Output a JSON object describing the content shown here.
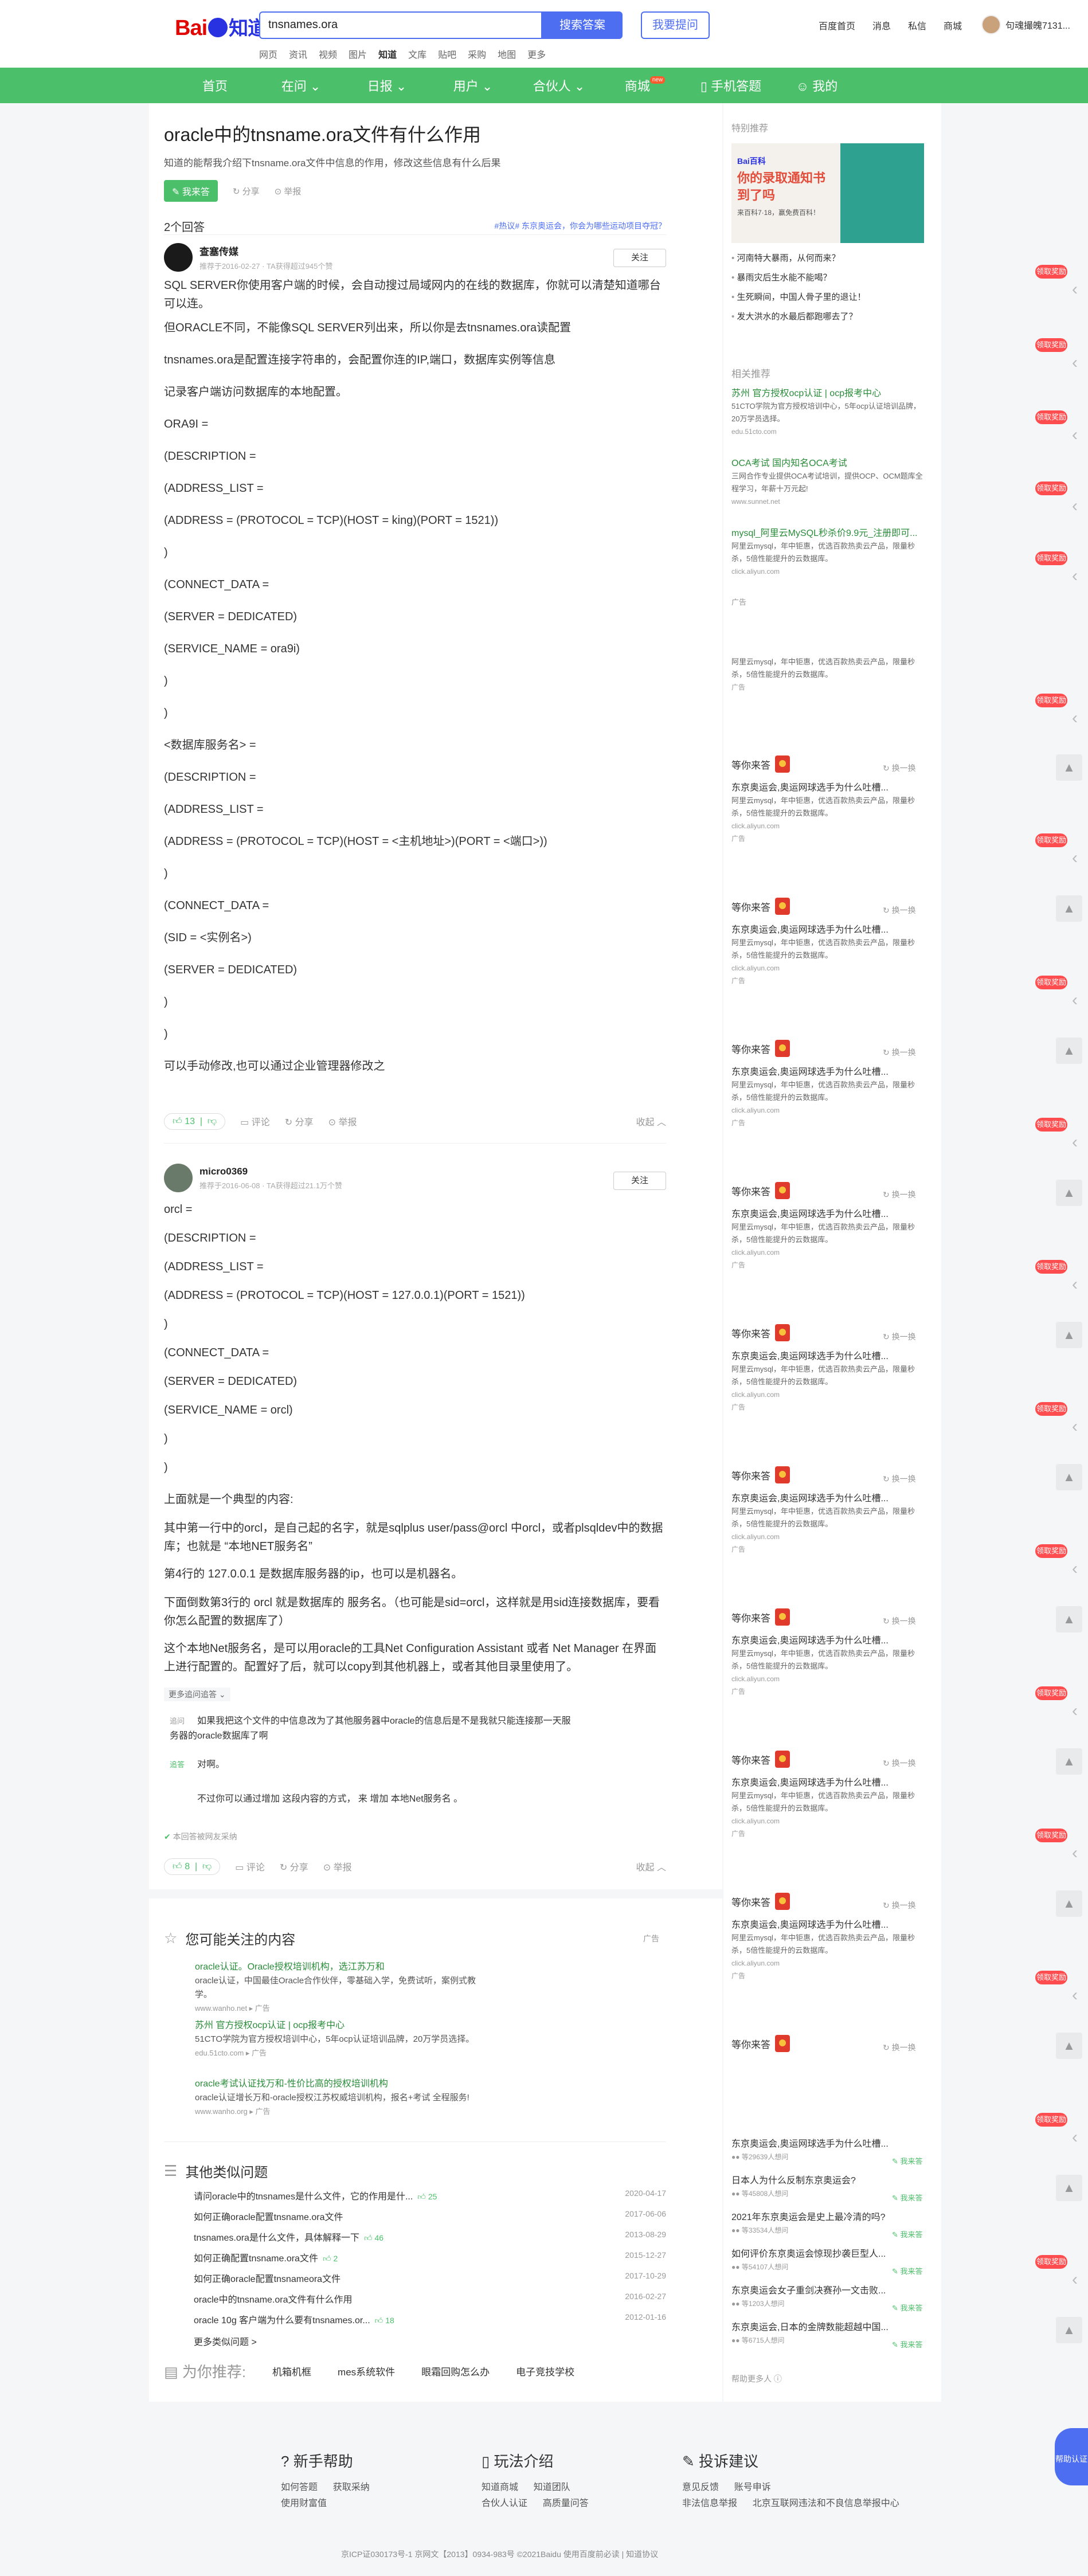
{
  "header": {
    "logo": {
      "bai": "Bai",
      "du": "du",
      "zhidao": "知道"
    },
    "search_value": "tnsnames.ora",
    "search_button": "搜索答案",
    "ask_button": "我要提问",
    "subnav": [
      "网页",
      "资讯",
      "视频",
      "图片",
      "知道",
      "文库",
      "贴吧",
      "采购",
      "地图",
      "更多"
    ],
    "links": [
      "百度首页",
      "消息",
      "私信",
      "商城"
    ],
    "username": "句魂撮魄7131..."
  },
  "nav": {
    "items": [
      "首页",
      "在问",
      "日报",
      "用户",
      "合伙人",
      "商城",
      "手机答题",
      "我的"
    ],
    "new_badge": "new"
  },
  "question": {
    "title": "oracle中的tnsname.ora文件有什么作用",
    "desc": "知道的能帮我介绍下tnsname.ora文件中信息的作用，修改这些信息有什么后果",
    "want_answer": "我来答",
    "share": "分享",
    "report": "举报"
  },
  "answers_bar": {
    "count": "2个回答",
    "hot": "#热议# 东京奥运会，你会为哪些运动项目夺冠？"
  },
  "answer1": {
    "name": "查塞传媒",
    "meta": "推荐于2016-02-27 · TA获得超过945个赞",
    "follow": "关注",
    "paras": [
      "SQL SERVER你使用客户端的时候，会自动搜过局域网内的在线的数据库，你就可以清楚知道哪台可以连。",
      "但ORACLE不同，不能像SQL SERVER列出来，所以你是去tnsnames.ora读配置",
      "tnsnames.ora是配置连接字符串的，会配置你连的IP,端口，数据库实例等信息",
      "记录客户端访问数据库的本地配置。",
      "ORA9I =",
      "(DESCRIPTION =",
      "(ADDRESS_LIST =",
      "(ADDRESS = (PROTOCOL = TCP)(HOST = king)(PORT = 1521))",
      ")",
      "(CONNECT_DATA =",
      "(SERVER = DEDICATED)",
      "(SERVICE_NAME = ora9i)",
      ")",
      ")",
      "<数据库服务名> =",
      "(DESCRIPTION =",
      "(ADDRESS_LIST =",
      "(ADDRESS = (PROTOCOL = TCP)(HOST = <主机地址>)(PORT = <端口>))",
      ")",
      "(CONNECT_DATA =",
      "(SID = <实例名>)",
      "(SERVER = DEDICATED)",
      ")",
      ")",
      "可以手动修改,也可以通过企业管理器修改之"
    ],
    "likes": "13",
    "comment": "评论",
    "share": "分享",
    "report": "举报",
    "fold": "收起"
  },
  "answer2": {
    "name": "micro0369",
    "meta": "推荐于2016-06-08 · TA获得超过21.1万个赞",
    "follow": "关注",
    "paras": [
      "orcl =",
      "(DESCRIPTION =",
      "(ADDRESS_LIST =",
      "(ADDRESS = (PROTOCOL = TCP)(HOST = 127.0.0.1)(PORT = 1521))",
      ")",
      "(CONNECT_DATA =",
      "(SERVER = DEDICATED)",
      "(SERVICE_NAME = orcl)",
      ")",
      ")",
      "上面就是一个典型的内容:",
      "其中第一行中的orcl，是自己起的名字，就是sqlplus user/pass@orcl 中orcl，或者plsqldev中的数据库；也就是 “本地NET服务名”",
      "第4行的 127.0.0.1 是数据库服务器的ip，也可以是机器名。",
      "下面倒数第3行的 orcl 就是数据库的 服务名。（也可能是sid=orcl，这样就是用sid连接数据库，要看你怎么配置的数据库了）",
      "这个本地Net服务名，是可以用oracle的工具Net Configuration Assistant 或者 Net Manager 在界面上进行配置的。配置好了后，就可以copy到其他机器上，或者其他目录里使用了。"
    ],
    "more_qa": "更多追问追答",
    "q_tag": "追问",
    "q_text": "如果我把这个文件的中信息改为了其他服务器中oracle的信息后是不是我就只能连接那一天服务器的oracle数据库了啊",
    "a_tag": "追答",
    "a_text1": "对啊。",
    "a_text2": "不过你可以通过增加 这段内容的方式，  来 增加 本地Net服务名 。",
    "verify": "本回答被网友采纳",
    "likes": "8",
    "comment": "评论",
    "share": "分享",
    "report": "举报",
    "fold": "收起"
  },
  "interest": {
    "title": "您可能关注的内容",
    "ad": "广告",
    "items": [
      {
        "t": "oracle认证。Oracle授权培训机构，选江苏万和",
        "d": "oracle认证，中国最佳Oracle合作伙伴，零基础入学，免费试听，案例式教学。",
        "u": "www.wanho.net  ▸  广告"
      },
      {
        "t": "苏州 官方授权ocp认证 | ocp报考中心",
        "d": "51CTO学院为官方授权培训中心，5年ocp认证培训品牌，20万学员选择。",
        "u": "edu.51cto.com  ▸  广告"
      },
      {
        "t": "oracle考试认证找万和-性价比高的授权培训机构",
        "d": "oracle认证增长万和-oracle授权江苏权威培训机构，报名+考试 全程服务!",
        "u": "www.wanho.org  ▸  广告"
      }
    ]
  },
  "similar": {
    "title": "其他类似问题",
    "items": [
      {
        "q": "请问oracle中的tnsnames是什么文件，它的作用是什...",
        "c": "25",
        "d": "2020-04-17"
      },
      {
        "q": "如何正确oracle配置tnsname.ora文件",
        "c": "",
        "d": "2017-06-06"
      },
      {
        "q": "tnsnames.ora是什么文件，具体解释一下",
        "c": "46",
        "d": "2013-08-29"
      },
      {
        "q": "如何正确配置tnsname.ora文件",
        "c": "2",
        "d": "2015-12-27"
      },
      {
        "q": "如何正确oracle配置tnsnameora文件",
        "c": "",
        "d": "2017-10-29"
      },
      {
        "q": "oracle中的tnsname.ora文件有什么作用",
        "c": "",
        "d": "2016-02-27"
      },
      {
        "q": "oracle 10g 客户端为什么要有tnsnames.or...",
        "c": "18",
        "d": "2012-01-16"
      }
    ],
    "more": "更多类似问题 >"
  },
  "recommend": {
    "label": "为你推荐:",
    "items": [
      "机箱机框",
      "mes系统软件",
      "眼霜回购怎么办",
      "电子竞技学校"
    ]
  },
  "side": {
    "special": "特别推荐",
    "banner": {
      "logo": "Bai百科",
      "text": "你的录取通知书到了吗",
      "sub": "来百科7·18，赢免费百科！"
    },
    "news": [
      "河南特大暴雨，从何而来？",
      "暴雨灾后生水能不能喝？",
      "生死瞬间，中国人骨子里的退让！",
      "发大洪水的水最后都跑哪去了？"
    ],
    "related_title": "相关推荐",
    "related": [
      {
        "t": "苏州 官方授权ocp认证 | ocp报考中心",
        "d": "51CTO学院为官方授权培训中心，5年ocp认证培训品牌，20万学员选择。",
        "u": "edu.51cto.com"
      },
      {
        "t": "OCA考试 国内知名OCA考试",
        "d": "三网合作专业提供OCA考试培训，提供OCP、OCM题库全程学习，年薪十万元起!",
        "u": "www.sunnet.net"
      },
      {
        "t": "mysql_阿里云MySQL秒杀价9.9元_注册即可...",
        "d": "阿里云mysql，年中钜惠，优选百款热卖云产品，限量秒杀，5倍性能提升的云数据库。",
        "u": "click.aliyun.com"
      }
    ],
    "ad": "广告",
    "waiting": "等你来答",
    "change": "换一换",
    "wait_q": "东京奥运会,奥运网球选手为什么吐槽...",
    "wait_d": "阿里云mysql，年中钜惠，优选百款热卖云产品，限量秒杀，5倍性能提升的云数据库。",
    "wait_u": "click.aliyun.com",
    "last_list": [
      {
        "q": "东京奥运会,奥运网球选手为什么吐槽...",
        "n": "等29639人想问"
      },
      {
        "q": "日本人为什么反制东京奥运会?",
        "n": "等45808人想问"
      },
      {
        "q": "2021年东京奥运会是史上最冷清的吗?",
        "n": "等33534人想问"
      },
      {
        "q": "如何评价东京奥运会惊现抄袭巨型人...",
        "n": "等54107人想问"
      },
      {
        "q": "东京奥运会女子重剑决赛孙一文击败...",
        "n": "等1203人想问"
      },
      {
        "q": "东京奥运会,日本的金牌数能超越中国...",
        "n": "等6715人想问"
      }
    ],
    "i_answer": "我来答",
    "help_more": "帮助更多人 ⓘ",
    "red_tag": "领取奖励"
  },
  "footer": {
    "help": {
      "h": "新手帮助",
      "items": [
        "如何答题",
        "获取采纳",
        "使用财富值"
      ]
    },
    "play": {
      "h": "玩法介绍",
      "items": [
        "知道商城",
        "知道团队",
        "合伙人认证",
        "高质量问答"
      ]
    },
    "complain": {
      "h": "投诉建议",
      "items": [
        "意见反馈",
        "账号申诉",
        "非法信息举报",
        "北京互联网违法和不良信息举报中心"
      ]
    },
    "copy": "京ICP证030173号-1    京网文【2013】0934-983号      ©2021Baidu  使用百度前必读  |  知道协议",
    "help_btn": "帮助认证"
  }
}
